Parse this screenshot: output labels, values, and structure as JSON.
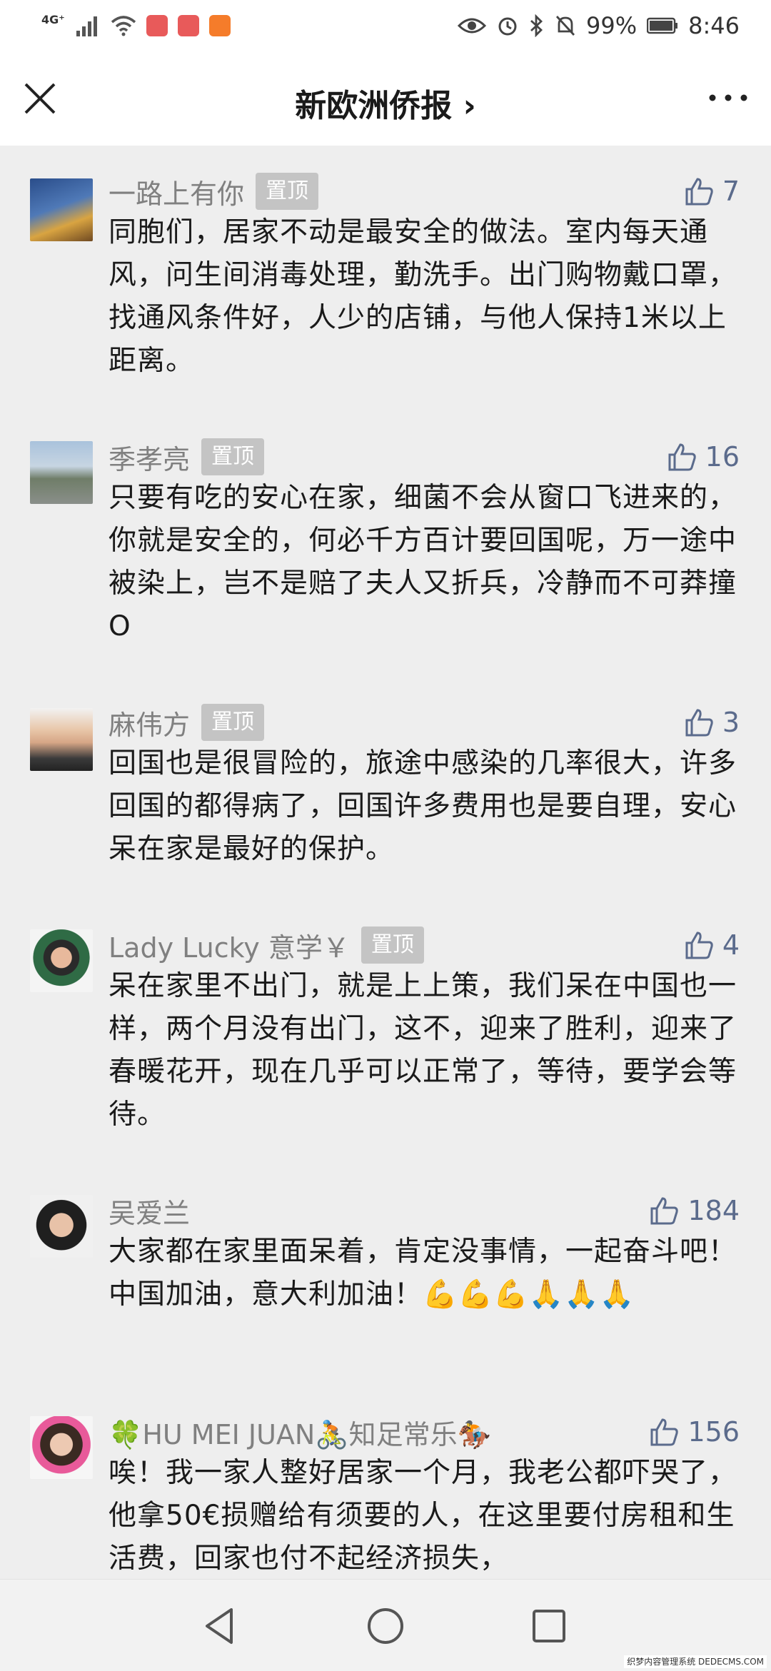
{
  "status_bar": {
    "network": "4G⁺",
    "battery_percent": "99%",
    "time": "8:46"
  },
  "header": {
    "title": "新欧洲侨报",
    "title_chevron": "›"
  },
  "pin_label": "置顶",
  "comments": [
    {
      "name": "一路上有你",
      "pinned": true,
      "likes": "7",
      "text": "同胞们，居家不动是最安全的做法。室内每天通风，问生间消毒处理，勤洗手。出门购物戴口罩，找通风条件好，人少的店铺，与他人保持1米以上距离。"
    },
    {
      "name": "季孝亮",
      "pinned": true,
      "likes": "16",
      "text": "只要有吃的安心在家，细菌不会从窗口飞进来的，你就是安全的，何必千方百计要回国呢，万一途中被染上，岂不是赔了夫人又折兵，冷静而不可莽撞O"
    },
    {
      "name": "麻伟方",
      "pinned": true,
      "likes": "3",
      "text": "回国也是很冒险的，旅途中感染的几率很大，许多回国的都得病了，回国许多费用也是要自理，安心呆在家是最好的保护。"
    },
    {
      "name": "Lady Lucky 意学￥",
      "pinned": true,
      "likes": "4",
      "text": "呆在家里不出门，就是上上策，我们呆在中国也一样，两个月没有出门，这不，迎来了胜利，迎来了春暖花开，现在几乎可以正常了，等待，要学会等待。"
    },
    {
      "name": "吴爱兰",
      "pinned": false,
      "likes": "184",
      "text": "大家都在家里面呆着，肯定没事情，一起奋斗吧！中国加油，意大利加油！💪💪💪🙏🙏🙏"
    },
    {
      "name": "🍀HU MEI JUAN🚴知足常乐🏇",
      "pinned": false,
      "likes": "156",
      "text": "唉！我一家人整好居家一个月，我老公都吓哭了，他拿50€损赠给有须要的人，在这里要付房租和生活费，回家也付不起经济损失，"
    }
  ],
  "watermark": "织梦内容管理系统 DEDECMS.COM",
  "colors": {
    "like": "#5b6b8c",
    "pin_bg": "#c4c4c4",
    "name": "#808080"
  }
}
